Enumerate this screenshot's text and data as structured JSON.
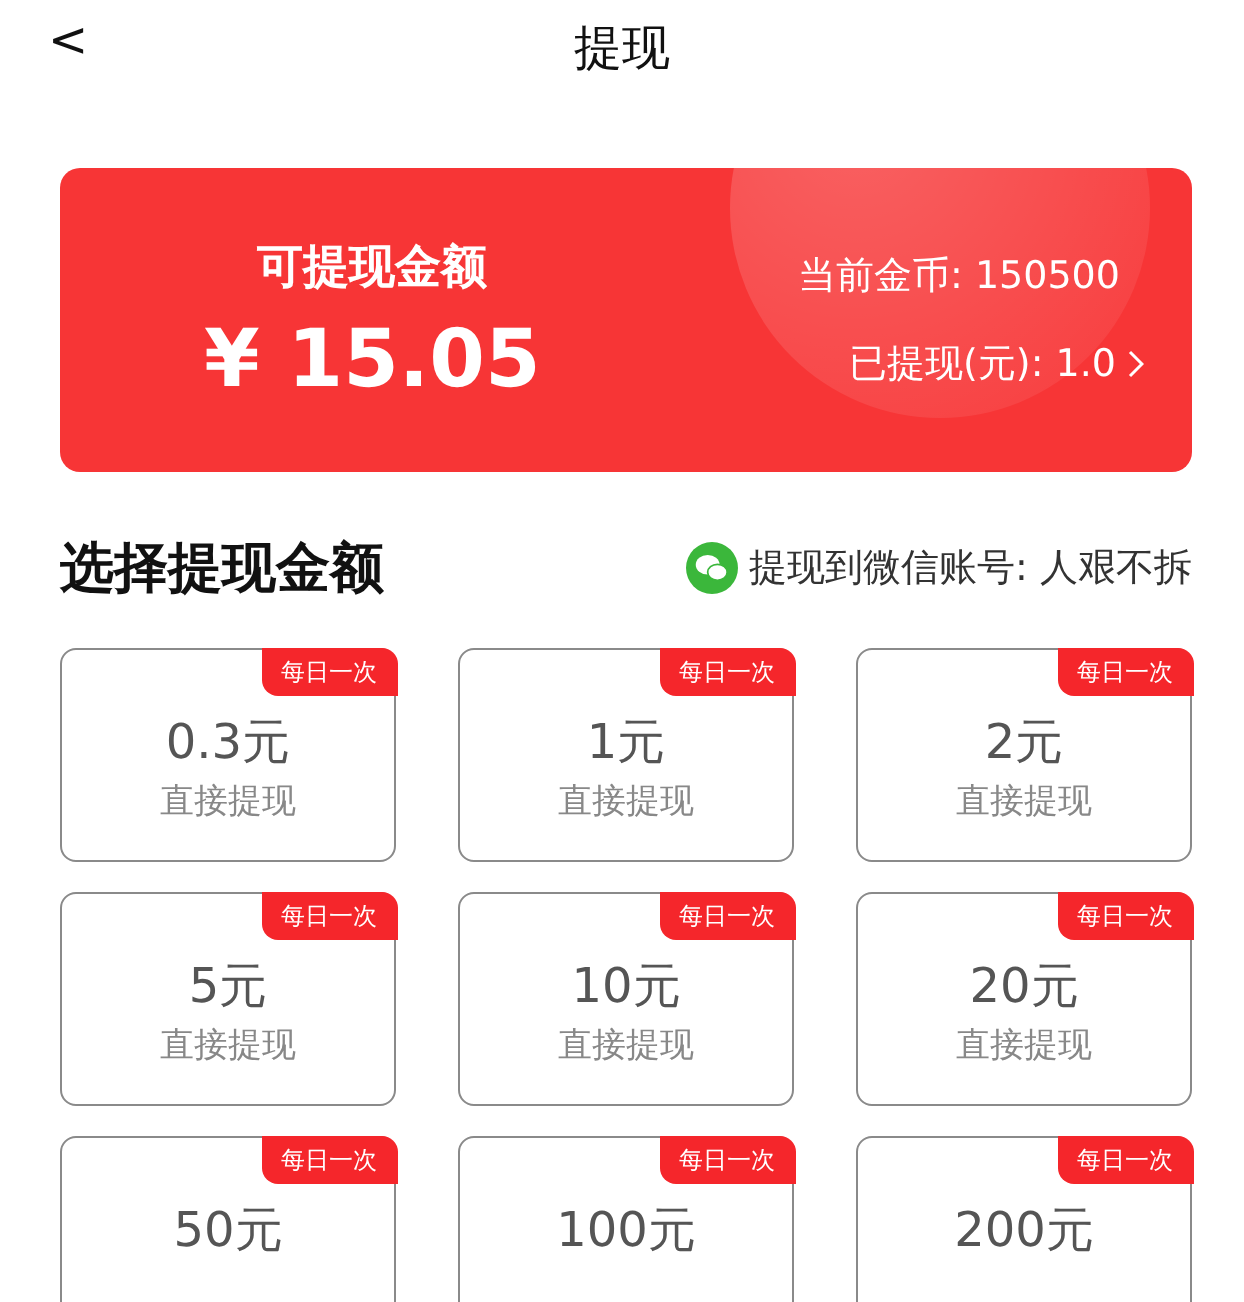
{
  "header": {
    "back": "<",
    "title": "提现"
  },
  "balance_card": {
    "label": "可提现金额",
    "amount": "¥ 15.05",
    "coins": "当前金币: 150500",
    "withdrawn": "已提现(元): 1.0"
  },
  "section": {
    "title": "选择提现金额",
    "account": "提现到微信账号: 人艰不拆"
  },
  "options": [
    {
      "amount": "0.3元",
      "note": "直接提现",
      "badge": "每日一次"
    },
    {
      "amount": "1元",
      "note": "直接提现",
      "badge": "每日一次"
    },
    {
      "amount": "2元",
      "note": "直接提现",
      "badge": "每日一次"
    },
    {
      "amount": "5元",
      "note": "直接提现",
      "badge": "每日一次"
    },
    {
      "amount": "10元",
      "note": "直接提现",
      "badge": "每日一次"
    },
    {
      "amount": "20元",
      "note": "直接提现",
      "badge": "每日一次"
    },
    {
      "amount": "50元",
      "badge": "每日一次"
    },
    {
      "amount": "100元",
      "badge": "每日一次"
    },
    {
      "amount": "200元",
      "badge": "每日一次"
    }
  ]
}
